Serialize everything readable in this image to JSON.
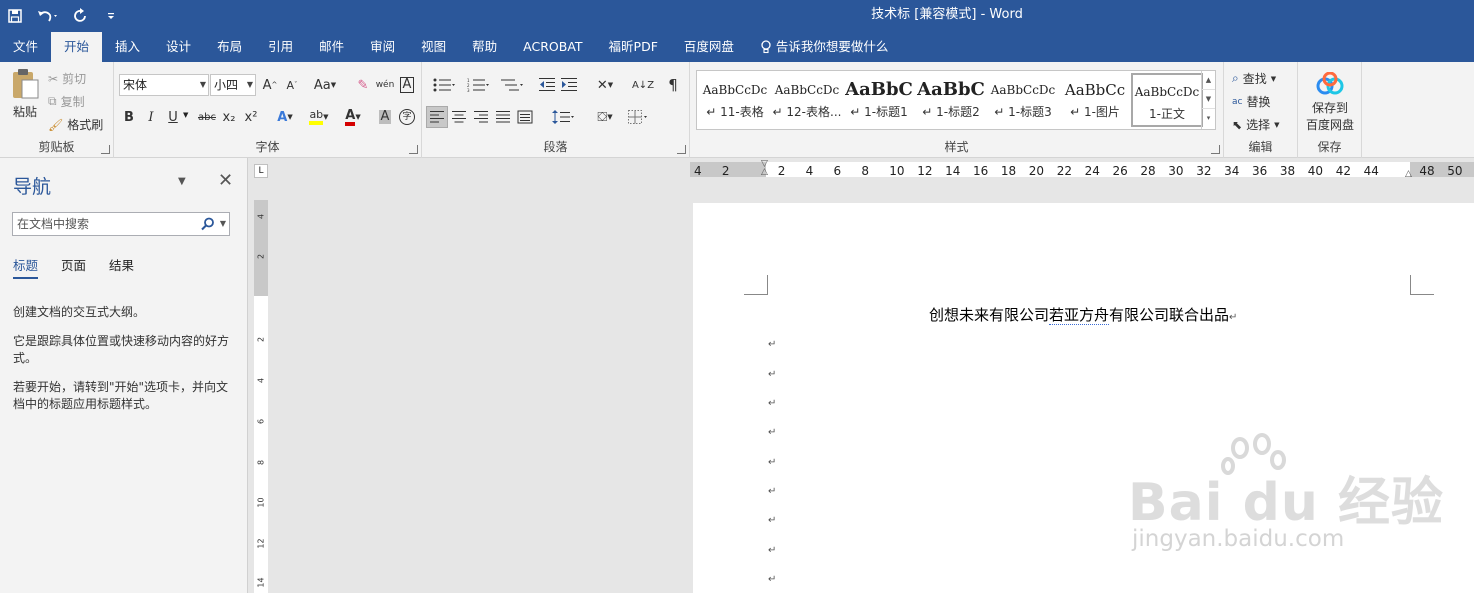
{
  "window": {
    "title": "技术标 [兼容模式]  -  Word"
  },
  "tabs": [
    "文件",
    "开始",
    "插入",
    "设计",
    "布局",
    "引用",
    "邮件",
    "审阅",
    "视图",
    "帮助",
    "ACROBAT",
    "福昕PDF",
    "百度网盘"
  ],
  "tell_me": "告诉我你想要做什么",
  "clipboard": {
    "paste": "粘贴",
    "cut": "剪切",
    "copy": "复制",
    "format_painter": "格式刷",
    "label": "剪贴板"
  },
  "font": {
    "name": "宋体",
    "size": "小四",
    "label": "字体",
    "case_btn": "Aa",
    "grow": "A",
    "shrink": "A",
    "bold": "B",
    "italic": "I",
    "underline": "U",
    "strike": "abc",
    "sub": "x₂",
    "sup": "x²",
    "phonetic": "wén",
    "border_char": "A",
    "shade_char": "A",
    "enclose": "字"
  },
  "paragraph": {
    "label": "段落"
  },
  "styles": {
    "label": "样式",
    "items": [
      {
        "preview": "AaBbCcDc",
        "name": "↵ 11-表格"
      },
      {
        "preview": "AaBbCcDc",
        "name": "↵ 12-表格..."
      },
      {
        "preview": "AaBbC",
        "name": "↵ 1-标题1"
      },
      {
        "preview": "AaBbC",
        "name": "↵ 1-标题2"
      },
      {
        "preview": "AaBbCcDc",
        "name": "↵ 1-标题3"
      },
      {
        "preview": "AaBbCc",
        "name": "↵ 1-图片"
      },
      {
        "preview": "AaBbCcDc",
        "name": "1-正文"
      }
    ]
  },
  "editing": {
    "find": "查找",
    "replace": "替换",
    "select": "选择",
    "label": "编辑"
  },
  "save_group": {
    "line1": "保存到",
    "line2": "百度网盘",
    "label": "保存"
  },
  "nav": {
    "title": "导航",
    "search_placeholder": "在文档中搜索",
    "tabs": [
      "标题",
      "页面",
      "结果"
    ],
    "p1": "创建文档的交互式大纲。",
    "p2": "它是跟踪具体位置或快速移动内容的好方式。",
    "p3": "若要开始，请转到\"开始\"选项卡，并向文档中的标题应用标题样式。"
  },
  "ruler": {
    "h": [
      "4",
      "2",
      "",
      "2",
      "4",
      "6",
      "8",
      "10",
      "12",
      "14",
      "16",
      "18",
      "20",
      "22",
      "24",
      "26",
      "28",
      "30",
      "32",
      "34",
      "36",
      "38",
      "40",
      "42",
      "44",
      "",
      "48",
      "50"
    ],
    "v": [
      "4",
      "2",
      "",
      "2",
      "4",
      "6",
      "8",
      "10",
      "12",
      "14"
    ],
    "corner": "L"
  },
  "document": {
    "title_a": "创想未来有限公司",
    "title_b": "若亚方舟",
    "title_c": "有限公司联合出品",
    "pilcrow": "↵"
  },
  "watermark": {
    "brand": "Bai du 经验",
    "url": "jingyan.baidu.com"
  },
  "colors": {
    "ribbon_blue": "#2b579a",
    "font_color_red": "#d40000",
    "highlight_yellow": "#ffff00"
  }
}
